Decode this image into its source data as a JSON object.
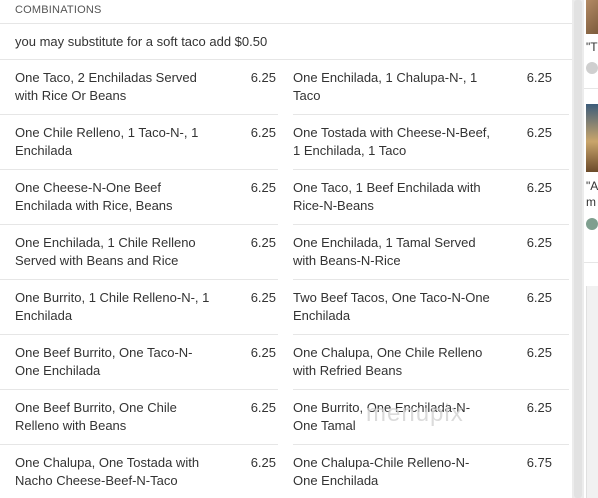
{
  "section": {
    "title": "COMBINATIONS",
    "note": "you may substitute for a soft taco add $0.50"
  },
  "items": [
    {
      "left": {
        "name": "One Taco, 2 Enchiladas Served with Rice Or Beans",
        "price": "6.25"
      },
      "right": {
        "name": "One Enchilada, 1 Chalupa-N-, 1 Taco",
        "price": "6.25"
      }
    },
    {
      "left": {
        "name": "One Chile Relleno, 1 Taco-N-, 1 Enchilada",
        "price": "6.25"
      },
      "right": {
        "name": "One Tostada with Cheese-N-Beef, 1 Enchilada, 1 Taco",
        "price": "6.25"
      }
    },
    {
      "left": {
        "name": "One Cheese-N-One Beef Enchilada with Rice, Beans",
        "price": "6.25"
      },
      "right": {
        "name": "One Taco, 1 Beef Enchilada with Rice-N-Beans",
        "price": "6.25"
      }
    },
    {
      "left": {
        "name": "One Enchilada, 1 Chile Relleno Served with Beans and Rice",
        "price": "6.25"
      },
      "right": {
        "name": "One Enchilada, 1 Tamal Served with Beans-N-Rice",
        "price": "6.25"
      }
    },
    {
      "left": {
        "name": "One Burrito, 1 Chile Relleno-N-, 1 Enchilada",
        "price": "6.25"
      },
      "right": {
        "name": "Two Beef Tacos, One Taco-N-One Enchilada",
        "price": "6.25"
      }
    },
    {
      "left": {
        "name": "One Beef Burrito, One Taco-N-One Enchilada",
        "price": "6.25"
      },
      "right": {
        "name": "One Chalupa, One Chile Relleno with Refried Beans",
        "price": "6.25"
      }
    },
    {
      "left": {
        "name": "One Beef Burrito, One Chile Relleno with Beans",
        "price": "6.25"
      },
      "right": {
        "name": "One Burrito, One Enchilada-N-One Tamal",
        "price": "6.25"
      }
    },
    {
      "left": {
        "name": "One Chalupa, One Tostada with Nacho Cheese-Beef-N-Taco",
        "price": "6.25"
      },
      "right": {
        "name": "One Chalupa-Chile Relleno-N-One Enchilada",
        "price": "6.75"
      }
    }
  ],
  "watermark": "menupix",
  "sidebar": {
    "quote_1": "\"T",
    "quote_2": "\"A",
    "quote_2b": "m"
  }
}
